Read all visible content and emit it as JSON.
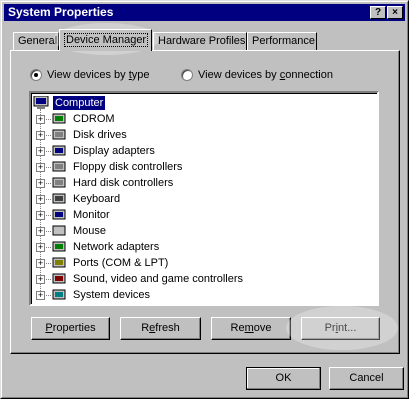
{
  "window": {
    "title": "System Properties"
  },
  "titlebar_buttons": {
    "help": "?",
    "close": "×"
  },
  "tabs": [
    {
      "label": "General"
    },
    {
      "label": "Device Manager"
    },
    {
      "label": "Hardware Profiles"
    },
    {
      "label": "Performance"
    }
  ],
  "view_options": {
    "by_type": {
      "label_pre": "View devices by ",
      "label_key": "t",
      "label_post": "ype"
    },
    "by_connection": {
      "label_pre": "View devices by ",
      "label_key": "c",
      "label_post": "onnection"
    }
  },
  "tree": {
    "root": "Computer",
    "items": [
      {
        "label": "CDROM",
        "icon": "cdrom-icon"
      },
      {
        "label": "Disk drives",
        "icon": "disk-drive-icon"
      },
      {
        "label": "Display adapters",
        "icon": "display-adapter-icon"
      },
      {
        "label": "Floppy disk controllers",
        "icon": "floppy-controller-icon"
      },
      {
        "label": "Hard disk controllers",
        "icon": "hard-disk-controller-icon"
      },
      {
        "label": "Keyboard",
        "icon": "keyboard-icon"
      },
      {
        "label": "Monitor",
        "icon": "monitor-icon"
      },
      {
        "label": "Mouse",
        "icon": "mouse-icon"
      },
      {
        "label": "Network adapters",
        "icon": "network-adapter-icon"
      },
      {
        "label": "Ports (COM & LPT)",
        "icon": "ports-icon"
      },
      {
        "label": "Sound, video and game controllers",
        "icon": "sound-icon"
      },
      {
        "label": "System devices",
        "icon": "system-devices-icon"
      }
    ]
  },
  "buttons": {
    "properties": {
      "pre": "",
      "key": "P",
      "post": "roperties"
    },
    "refresh": {
      "pre": "R",
      "key": "e",
      "post": "fresh"
    },
    "remove": {
      "pre": "Re",
      "key": "m",
      "post": "ove"
    },
    "print": {
      "pre": "Pr",
      "key": "i",
      "post": "nt..."
    },
    "ok": "OK",
    "cancel": "Cancel"
  },
  "colors": {
    "face": "#c0c0c0",
    "title": "#000080",
    "selection": "#000080"
  }
}
